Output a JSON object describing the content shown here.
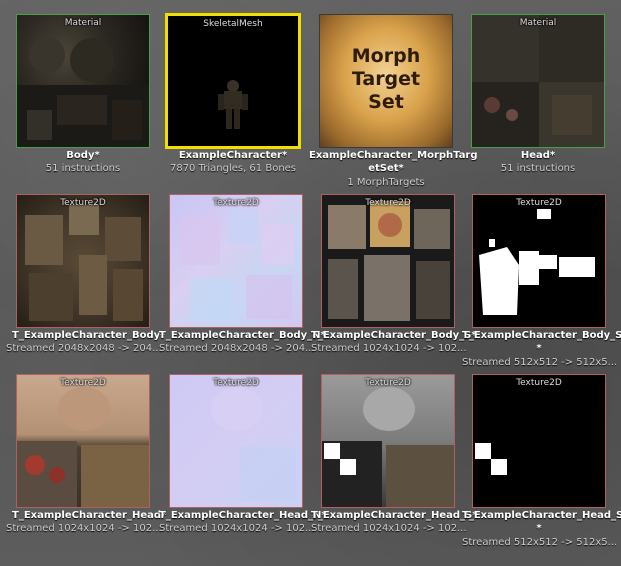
{
  "assets": [
    {
      "type": "Material",
      "name": "Body*",
      "info": "51 instructions"
    },
    {
      "type": "SkeletalMesh",
      "name": "ExampleCharacter*",
      "info": "7870 Triangles, 61 Bones"
    },
    {
      "type": "",
      "name_line1": "ExampleCharacter_MorphTarg",
      "name_line2": "etSet*",
      "info": "1 MorphTargets",
      "thumb_text": [
        "Morph",
        "Target",
        "Set"
      ]
    },
    {
      "type": "Material",
      "name": "Head*",
      "info": "51 instructions"
    },
    {
      "type": "Texture2D",
      "name": "T_ExampleCharacter_Body*",
      "info": "Streamed 2048x2048 -> 204..."
    },
    {
      "type": "Texture2D",
      "name": "T_ExampleCharacter_Body_N*",
      "info": "Streamed 2048x2048 -> 204..."
    },
    {
      "type": "Texture2D",
      "name": "T_ExampleCharacter_Body_S*",
      "info": "Streamed 1024x1024 -> 102..."
    },
    {
      "type": "Texture2D",
      "name_line1": "T_ExampleCharacter_Body_SP",
      "name_line2": "*",
      "info": "Streamed 512x512 -> 512x5..."
    },
    {
      "type": "Texture2D",
      "name": "T_ExampleCharacter_Head*",
      "info": "Streamed 1024x1024 -> 102..."
    },
    {
      "type": "Texture2D",
      "name": "T_ExampleCharacter_Head_N*",
      "info": "Streamed 1024x1024 -> 102..."
    },
    {
      "type": "Texture2D",
      "name": "T_ExampleCharacter_Head_S*",
      "info": "Streamed 1024x1024 -> 102..."
    },
    {
      "type": "Texture2D",
      "name_line1": "T_ExampleCharacter_Head_SP",
      "name_line2": "*",
      "info": "Streamed 512x512 -> 512x5..."
    }
  ],
  "colors": {
    "selected": "#f0e000",
    "material_border": "#4a9e4a",
    "texture_border": "#b06060"
  }
}
